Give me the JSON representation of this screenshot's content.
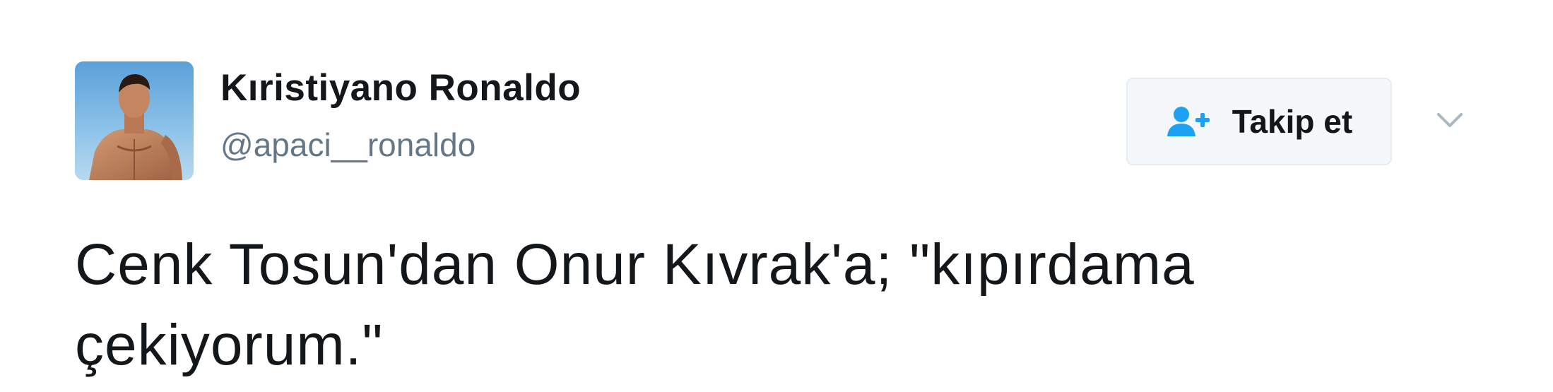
{
  "author": {
    "display_name": "Kıristiyano Ronaldo",
    "screen_name": "@apaci__ronaldo",
    "avatar_icon": "profile-photo"
  },
  "follow_button": {
    "label": "Takip et",
    "icon": "add-user-icon"
  },
  "menu": {
    "icon": "chevron-down-icon"
  },
  "tweet": {
    "text_line_1": "Cenk Tosun'dan Onur Kıvrak'a; \"kıpırdama",
    "text_line_2": "çekiyorum.\""
  },
  "colors": {
    "text": "#14171a",
    "secondary": "#657786",
    "accent": "#1da1f2",
    "button_bg": "#f5f8fa"
  }
}
